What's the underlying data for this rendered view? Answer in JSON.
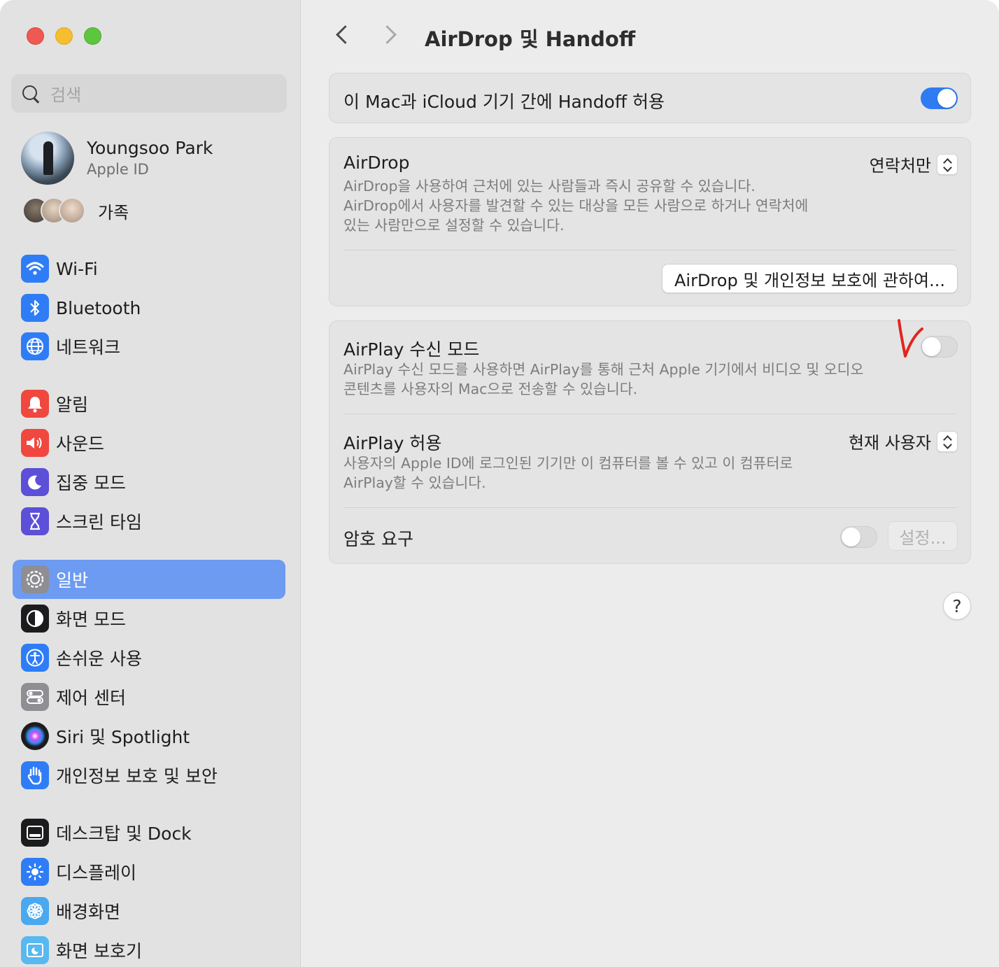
{
  "window": {
    "traffic_lights": [
      "close",
      "minimize",
      "zoom"
    ]
  },
  "sidebar": {
    "search_placeholder": "검색",
    "profile": {
      "name": "Youngsoo Park",
      "subtitle": "Apple ID"
    },
    "family_label": "가족",
    "items": [
      {
        "label": "Wi-Fi",
        "icon": "wifi-icon",
        "color": "#2f7df6"
      },
      {
        "label": "Bluetooth",
        "icon": "bluetooth-icon",
        "color": "#2f7df6"
      },
      {
        "label": "네트워크",
        "icon": "globe-icon",
        "color": "#2f7df6"
      },
      {
        "label": "알림",
        "icon": "bell-icon",
        "color": "#f0483e"
      },
      {
        "label": "사운드",
        "icon": "speaker-icon",
        "color": "#f0483e"
      },
      {
        "label": "집중 모드",
        "icon": "moon-icon",
        "color": "#5c4fd8"
      },
      {
        "label": "스크린 타임",
        "icon": "hourglass-icon",
        "color": "#5c4fd8"
      },
      {
        "label": "일반",
        "icon": "gear-icon",
        "color": "#8e8e93",
        "selected": true
      },
      {
        "label": "화면 모드",
        "icon": "appearance-icon",
        "color": "#1c1c1e"
      },
      {
        "label": "손쉬운 사용",
        "icon": "accessibility-icon",
        "color": "#2f7df6"
      },
      {
        "label": "제어 센터",
        "icon": "switches-icon",
        "color": "#8e8e93"
      },
      {
        "label": "Siri 및 Spotlight",
        "icon": "siri-icon",
        "color": "#1c1c1e"
      },
      {
        "label": "개인정보 보호 및 보안",
        "icon": "hand-icon",
        "color": "#2f7df6"
      },
      {
        "label": "데스크탑 및 Dock",
        "icon": "dock-icon",
        "color": "#1c1c1e"
      },
      {
        "label": "디스플레이",
        "icon": "sun-icon",
        "color": "#2f7df6"
      },
      {
        "label": "배경화면",
        "icon": "flower-icon",
        "color": "#4aa8f0"
      },
      {
        "label": "화면 보호기",
        "icon": "screensaver-icon",
        "color": "#58b8f0"
      }
    ]
  },
  "main": {
    "title": "AirDrop 및 Handoff",
    "handoff": {
      "label": "이 Mac과 iCloud 기기 간에 Handoff 허용",
      "enabled": true
    },
    "airdrop": {
      "title": "AirDrop",
      "desc_lines": [
        "AirDrop을 사용하여 근처에 있는 사람들과 즉시 공유할 수 있습니다.",
        "AirDrop에서 사용자를 발견할 수 있는 대상을 모든 사람으로 하거나 연락처에",
        "있는 사람만으로 설정할 수 있습니다."
      ],
      "value": "연락처만",
      "button": "AirDrop 및 개인정보 보호에 관하여..."
    },
    "airplay_receiver": {
      "title": "AirPlay 수신 모드",
      "desc_lines": [
        "AirPlay 수신 모드를 사용하면 AirPlay를 통해 근처 Apple 기기에서 비디오 및 오디오",
        "콘텐츠를 사용자의 Mac으로 전송할 수 있습니다."
      ],
      "enabled": false
    },
    "airplay_allow": {
      "title": "AirPlay 허용",
      "desc_lines": [
        "사용자의 Apple ID에 로그인된 기기만 이 컴퓨터를 볼 수 있고 이 컴퓨터로",
        "AirPlay할 수 있습니다."
      ],
      "value": "현재 사용자"
    },
    "password": {
      "title": "암호 요구",
      "enabled": false,
      "button": "설정..."
    },
    "help": "?"
  },
  "colors": {
    "accent": "#2f7bf3",
    "selection": "#6d9bf2",
    "annotation": "#e0261f"
  }
}
